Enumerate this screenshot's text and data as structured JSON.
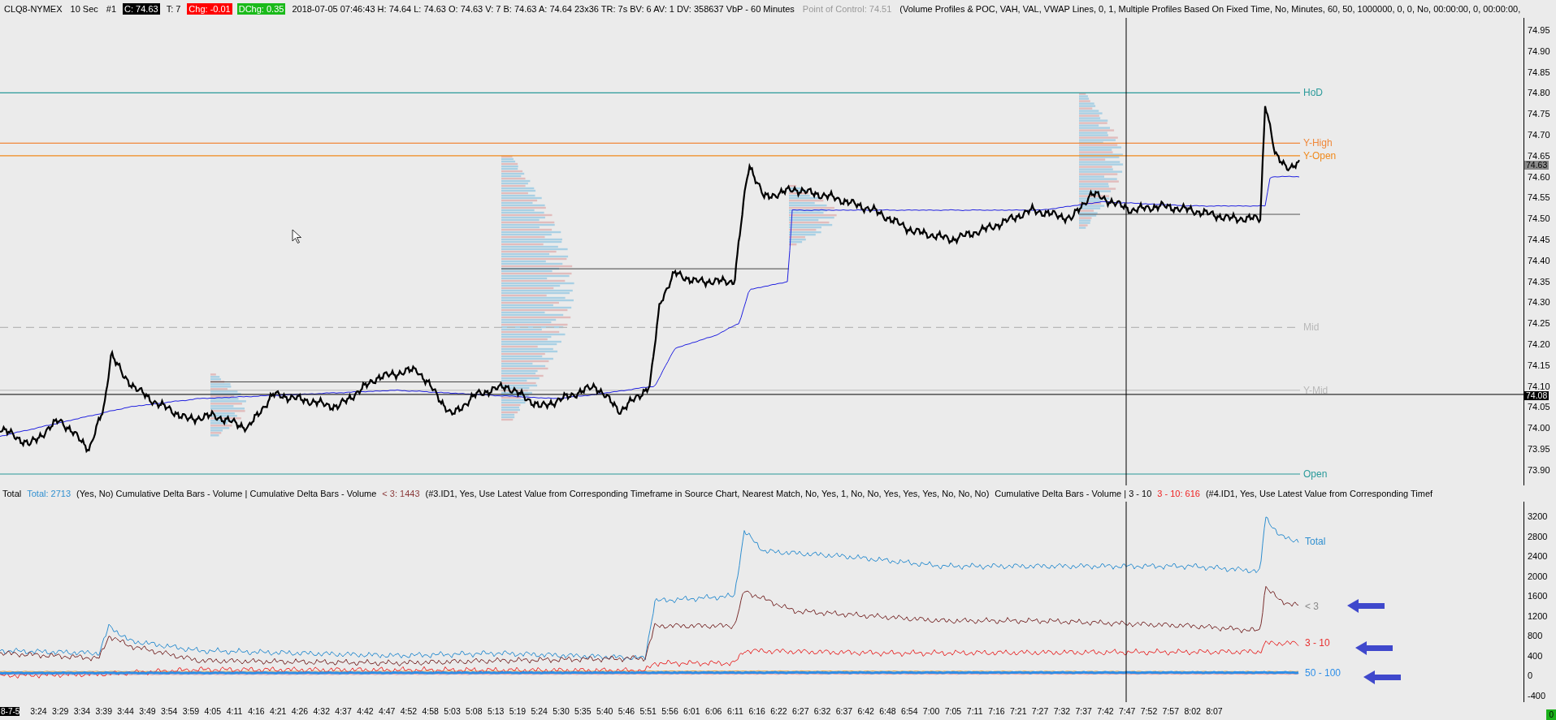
{
  "header": {
    "items": [
      {
        "text": "CLQ8-NYMEX",
        "kind": "plain"
      },
      {
        "text": "10 Sec",
        "kind": "plain"
      },
      {
        "text": "#1",
        "kind": "plain"
      },
      {
        "text": "C: 74.63",
        "kind": "close"
      },
      {
        "text": "T: 7",
        "kind": "plain"
      },
      {
        "text": "Chg: -0.01",
        "kind": "down"
      },
      {
        "text": "DChg: 0.35",
        "kind": "up"
      },
      {
        "text": "2018-07-05 07:46:43 H: 74.64 L: 74.63 O: 74.63 V: 7 B: 74.63 A: 74.64 23x36 TR: 7s BV: 6 AV: 1 DV: 358637 VbP - 60 Minutes",
        "kind": "plain"
      },
      {
        "text": "Point of Control: 74.51",
        "kind": "muted"
      },
      {
        "text": "(Volume Profiles & POC, VAH, VAL, VWAP Lines, 0, 1, Multiple Profiles Based On Fixed Time, No, Minutes, 60, 50, 1000000, 0, 0, No, 00:00:00, 0, 00:00:00,",
        "kind": "plain"
      }
    ]
  },
  "price_pane": {
    "line_labels": [
      {
        "text": "HoD",
        "color": "#2a9a9a",
        "kind": "solid"
      },
      {
        "text": "Y-High",
        "color": "#f0883a",
        "kind": "solid"
      },
      {
        "text": "Y-Open",
        "color": "#f08a1c",
        "kind": "solid"
      },
      {
        "text": "Mid",
        "color": "#b8b8b8",
        "kind": "dashed"
      },
      {
        "text": "Y-Mid",
        "color": "#b8b8b8",
        "kind": "solid"
      },
      {
        "text": "Open",
        "color": "#2a9a9a",
        "kind": "solid"
      }
    ]
  },
  "price_axis": {
    "ticks": [
      "74.95",
      "74.90",
      "74.85",
      "74.80",
      "74.75",
      "74.70",
      "74.65",
      "74.60",
      "74.55",
      "74.50",
      "74.45",
      "74.40",
      "74.35",
      "74.30",
      "74.25",
      "74.20",
      "74.15",
      "74.10",
      "74.05",
      "74.00",
      "73.95",
      "73.90"
    ],
    "markers": [
      {
        "text": "74.63",
        "kind": "last"
      },
      {
        "text": "74.08",
        "kind": "crosshair"
      }
    ]
  },
  "lower_header": {
    "items": [
      {
        "text": "Total",
        "kind": "plain"
      },
      {
        "text": "Total: 2713",
        "kind": "blue"
      },
      {
        "text": "(Yes, No)  Cumulative Delta Bars - Volume | Cumulative Delta Bars - Volume",
        "kind": "plain"
      },
      {
        "text": "< 3: 1443",
        "kind": "brown"
      },
      {
        "text": "(#3.ID1, Yes, Use Latest Value from Corresponding Timeframe in Source Chart, Nearest Match, No, Yes, 1, No, No, Yes, Yes, Yes, No, No, No)",
        "kind": "plain"
      },
      {
        "text": "Cumulative Delta Bars - Volume | 3 - 10",
        "kind": "plain"
      },
      {
        "text": "3 - 10: 616",
        "kind": "red"
      },
      {
        "text": "(#4.ID1, Yes, Use Latest Value from Corresponding Timef",
        "kind": "plain"
      }
    ]
  },
  "lower_pane": {
    "line_labels": [
      {
        "text": "Total",
        "color": "#2f8fd0"
      },
      {
        "text": "< 3",
        "color": "#8a8a8a"
      },
      {
        "text": "3 - 10",
        "color": "#e83030"
      },
      {
        "text": "50 - 100",
        "color": "#2f8fe8"
      }
    ]
  },
  "lower_axis": {
    "ticks": [
      "3200",
      "2800",
      "2400",
      "2000",
      "1600",
      "1200",
      "800",
      "400",
      "0",
      "-400"
    ]
  },
  "time_axis": {
    "date_label": "8-7-5",
    "ticks": [
      "3:24",
      "3:29",
      "3:34",
      "3:39",
      "3:44",
      "3:49",
      "3:54",
      "3:59",
      "4:05",
      "4:11",
      "4:16",
      "4:21",
      "4:26",
      "4:32",
      "4:37",
      "4:42",
      "4:47",
      "4:52",
      "4:58",
      "5:03",
      "5:08",
      "5:13",
      "5:19",
      "5:24",
      "5:30",
      "5:35",
      "5:40",
      "5:46",
      "5:51",
      "5:56",
      "6:01",
      "6:06",
      "6:11",
      "6:16",
      "6:22",
      "6:27",
      "6:32",
      "6:37",
      "6:42",
      "6:48",
      "6:54",
      "7:00",
      "7:05",
      "7:11",
      "7:16",
      "7:21",
      "7:27",
      "7:32",
      "7:37",
      "7:42",
      "7:47",
      "7:52",
      "7:57",
      "8:02",
      "8:07"
    ]
  },
  "status_badge": "0"
}
